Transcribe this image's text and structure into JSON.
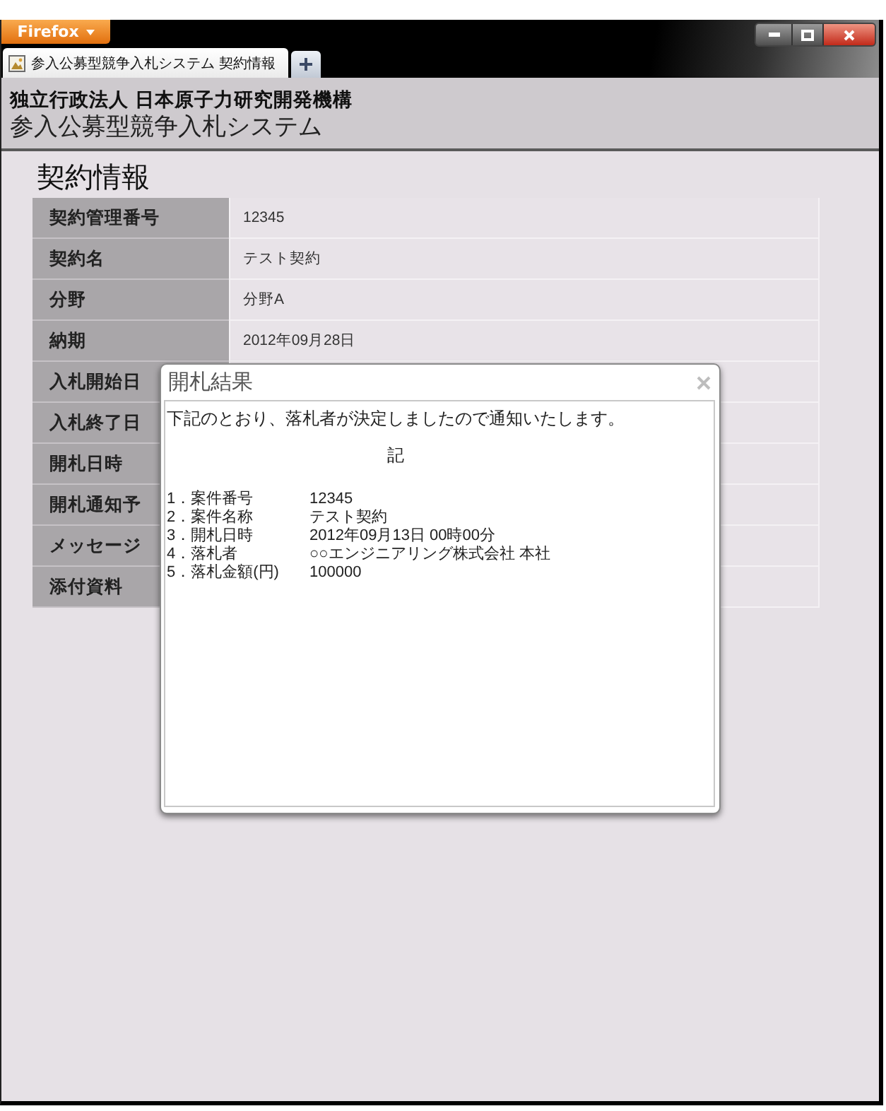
{
  "browser": {
    "menu_button": "Firefox",
    "tabs": [
      {
        "label": "参入公募型競争入札システム 契約情報",
        "selected": true
      }
    ]
  },
  "header": {
    "organization": "独立行政法人 日本原子力研究開発機構",
    "system_name": "参入公募型競争入札システム"
  },
  "page": {
    "title": "契約情報",
    "rows": [
      {
        "label": "契約管理番号",
        "value": "12345"
      },
      {
        "label": "契約名",
        "value": "テスト契約"
      },
      {
        "label": "分野",
        "value": "分野A"
      },
      {
        "label": "納期",
        "value": "2012年09月28日"
      },
      {
        "label": "入札開始日"
      },
      {
        "label": "入札終了日"
      },
      {
        "label": "開札日時"
      },
      {
        "label": "開札通知予"
      },
      {
        "label": "メッセージ"
      },
      {
        "label": "添付資料"
      }
    ]
  },
  "dialog": {
    "title": "開札結果",
    "message": "下記のとおり、落札者が決定しましたので通知いたします。",
    "heading": "記",
    "items": [
      {
        "label": "1．案件番号",
        "value": "12345"
      },
      {
        "label": "2．案件名称",
        "value": "テスト契約"
      },
      {
        "label": "3．開札日時",
        "value": "2012年09月13日 00時00分"
      },
      {
        "label": "4．落札者",
        "value": "○○エンジニアリング株式会社 本社"
      },
      {
        "label": "5．落札金額(円)",
        "value": "100000"
      }
    ]
  }
}
